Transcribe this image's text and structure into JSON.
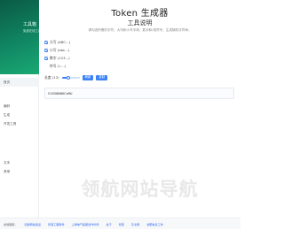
{
  "brand": {
    "title": "工具箱",
    "subtitle": "免费在线工具箱 · 工作者"
  },
  "sidebar": {
    "items": [
      "首页",
      "编码",
      "生成",
      "开发工具",
      "文本",
      "其他"
    ]
  },
  "header": {
    "title": "Token 生成器",
    "subtitle": "工具说明",
    "description": "请勾选所需的字符，大写和小写字母，数字和/或符号，生成随机字符串。"
  },
  "options": [
    {
      "label": "大写 (ABC...)",
      "checked": true
    },
    {
      "label": "小写 (abc...)",
      "checked": true
    },
    {
      "label": "数字 (123...)",
      "checked": true
    },
    {
      "label": "符号 (!-...)",
      "checked": false
    }
  ],
  "length": {
    "label": "长度 (12)",
    "value": 12,
    "max": 32
  },
  "buttons": {
    "refresh": "刷新",
    "copy": "复制"
  },
  "result": {
    "value": "V1EX8N0KCa9U"
  },
  "watermark": "领航网站导航",
  "footer": {
    "label": "友情链接：",
    "links": [
      "旧版网站建设",
      "智慧工程软件",
      "上海电气集团合作伙伴",
      "关于",
      "智慧",
      "东北网",
      "合肥信息工作"
    ]
  },
  "colors": {
    "brand": "#118a64",
    "accent": "#3b82f6"
  }
}
